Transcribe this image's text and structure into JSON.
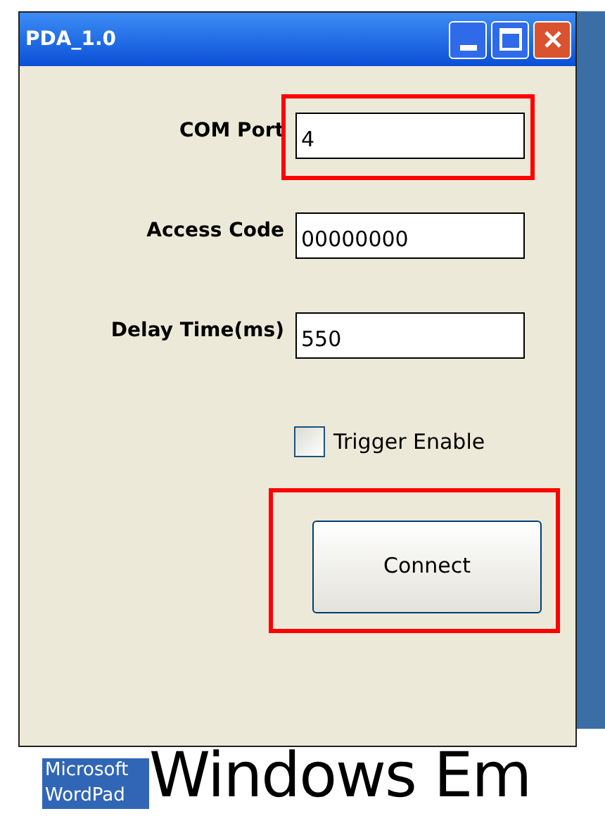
{
  "window": {
    "title": "PDA_1.0",
    "buttons": [
      {
        "kind": "minimize"
      },
      {
        "kind": "maximize"
      },
      {
        "kind": "close"
      }
    ]
  },
  "fields": [
    {
      "label": "COM Port",
      "value": "4",
      "highlighted": true
    },
    {
      "label": "Access Code",
      "value": "00000000",
      "highlighted": false
    },
    {
      "label": "Delay Time(ms)",
      "value": "550",
      "highlighted": false
    }
  ],
  "checkbox": {
    "label": "Trigger Enable",
    "checked": false
  },
  "connect_button": {
    "label": "Connect",
    "highlighted": true
  },
  "desktop": {
    "icon_label": [
      "Microsoft",
      "WordPad"
    ],
    "banner": "Windows Em"
  }
}
